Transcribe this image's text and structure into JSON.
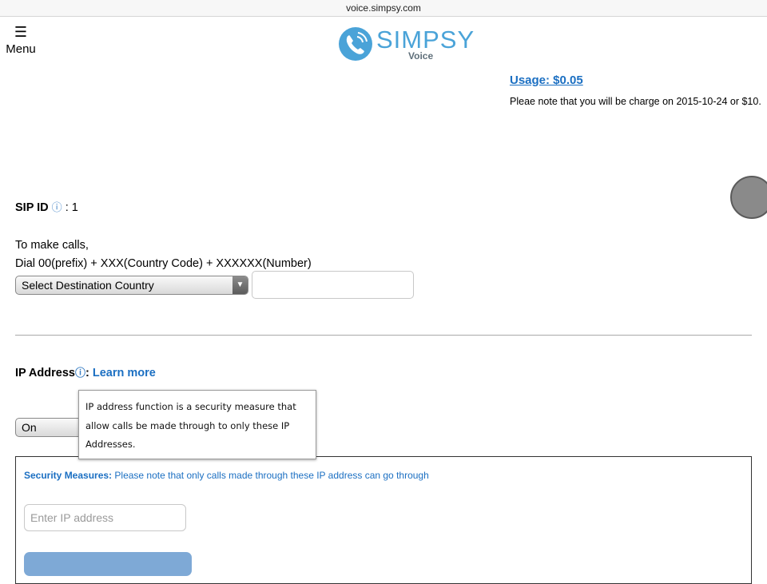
{
  "browser": {
    "url": "voice.simpsy.com"
  },
  "header": {
    "menu_icon": "hamburger-icon",
    "menu_glyph": "☰",
    "menu_label": "Menu",
    "logo_name": "SIMPSY",
    "logo_sub": "Voice",
    "logo_icon": "phone-icon"
  },
  "usage": {
    "label": "Usage: $0.05",
    "note": "Pleae note that you will be charge on 2015-10-24 or $10."
  },
  "sip": {
    "label": "SIP ID",
    "info_icon": "ⓘ",
    "value": ": 1"
  },
  "dial": {
    "line1": "To make calls,",
    "line2": "Dial 00(prefix) + XXX(Country Code) + XXXXXX(Number)",
    "country_select": "Select Destination Country",
    "number_value": ""
  },
  "ip": {
    "label": "IP Address",
    "info_icon": "ⓘ",
    "colon": ":",
    "learn_more": "Learn more",
    "toggle_value": "On",
    "tooltip": "IP address function is a security measure that allow calls be made through to only these IP Addresses."
  },
  "security": {
    "label": "Security Measures:",
    "text": " Please note that only calls made through these IP address can go through",
    "ip_placeholder": "Enter IP address",
    "ip_value": ""
  },
  "colors": {
    "brand": "#4aa3d8",
    "link": "#1b6fc2",
    "button": "#7ea9d6"
  }
}
